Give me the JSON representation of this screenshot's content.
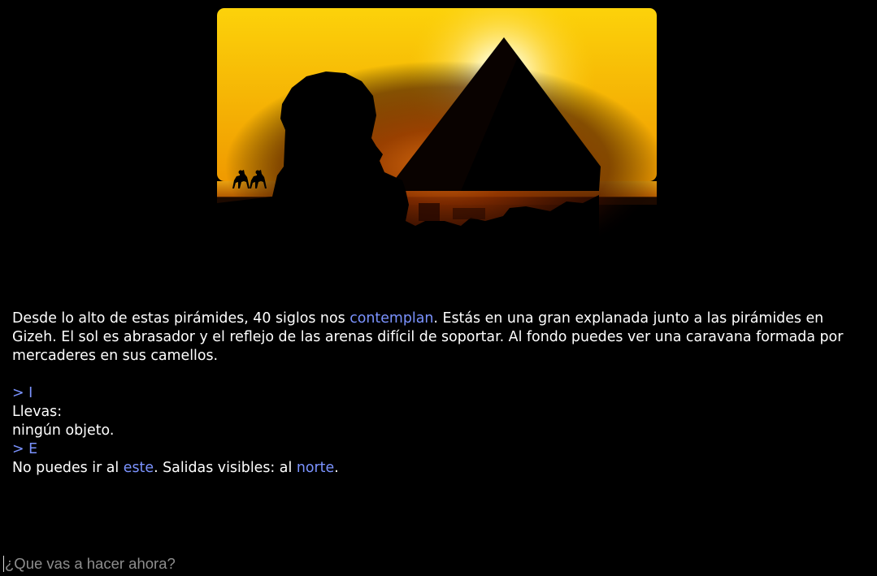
{
  "scene": {
    "icon": "pyramids-sphinx-sunset-illustration",
    "colors": {
      "sky_top": "#fcd20a",
      "sky_bottom": "#f09a00",
      "sun": "#fffbe0",
      "silhouette": "#000000",
      "glow": "#b84400"
    }
  },
  "description": {
    "part1": "Desde lo alto de estas pirámides, 40 siglos nos ",
    "link": "contemplan",
    "part2": ". Estás en una gran explanada junto a las pirámides en Gizeh. El sol es abrasador y el reflejo de las arenas difícil de soportar. Al fondo puedes ver una caravana formada por mercaderes en sus camellos."
  },
  "log": {
    "cmd1": "> I",
    "inventory_title": "Llevas:",
    "inventory_items": "ningún objeto.",
    "cmd2": "> E",
    "response_part1": "No puedes ir al ",
    "response_link1": "este",
    "response_part2": ". Salidas visibles: al ",
    "response_link2": "norte",
    "response_part3": "."
  },
  "input": {
    "placeholder": "¿Que vas a hacer ahora?",
    "value": ""
  },
  "theme": {
    "background": "#000000",
    "text": "#ffffff",
    "link": "#7b93ff",
    "placeholder": "#8e8e8e"
  }
}
